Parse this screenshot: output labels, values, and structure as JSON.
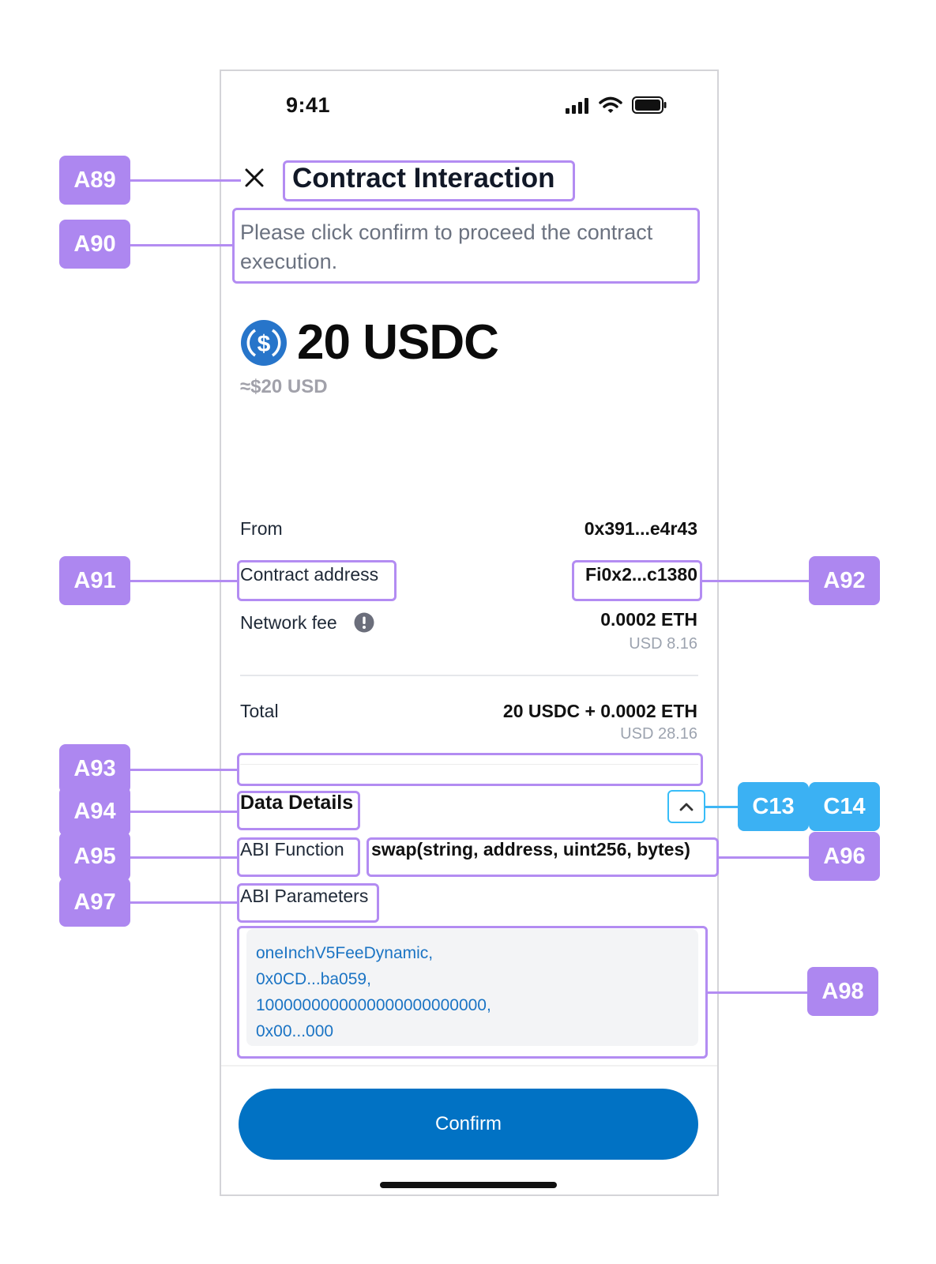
{
  "status_bar": {
    "time": "9:41"
  },
  "header": {
    "title": "Contract Interaction",
    "subtitle": "Please click confirm to proceed the  contract execution."
  },
  "amount": {
    "token_icon": "usdc-coin-icon",
    "value": "20 USDC",
    "usd": "≈$20 USD"
  },
  "details": {
    "from_label": "From",
    "from_value": "0x391...e4r43",
    "contract_label": "Contract address",
    "contract_value": "Fi0x2...c1380",
    "fee_label": "Network fee",
    "fee_value": "0.0002 ETH",
    "fee_usd": "USD 8.16",
    "total_label": "Total",
    "total_value": "20 USDC + 0.0002 ETH",
    "total_usd": "USD 28.16"
  },
  "data_details": {
    "title": "Data Details",
    "abi_function_label": "ABI Function",
    "abi_function_value": "swap(string, address, uint256, bytes)",
    "abi_parameters_label": "ABI Parameters",
    "params": [
      "oneInchV5FeeDynamic,",
      "0x0CD...ba059,",
      "1000000000000000000000000,",
      "0x00...000"
    ]
  },
  "actions": {
    "confirm_label": "Confirm"
  },
  "annotations": {
    "a89": "A89",
    "a90": "A90",
    "a91": "A91",
    "a92": "A92",
    "a93": "A93",
    "a94": "A94",
    "a95": "A95",
    "a96": "A96",
    "a97": "A97",
    "a98": "A98",
    "c13": "C13",
    "c14": "C14"
  },
  "colors": {
    "accent": "#0172c4",
    "annotation": "#ad87f0",
    "annotation_blue": "#3bb1f3",
    "param_text": "#1b74c4"
  }
}
